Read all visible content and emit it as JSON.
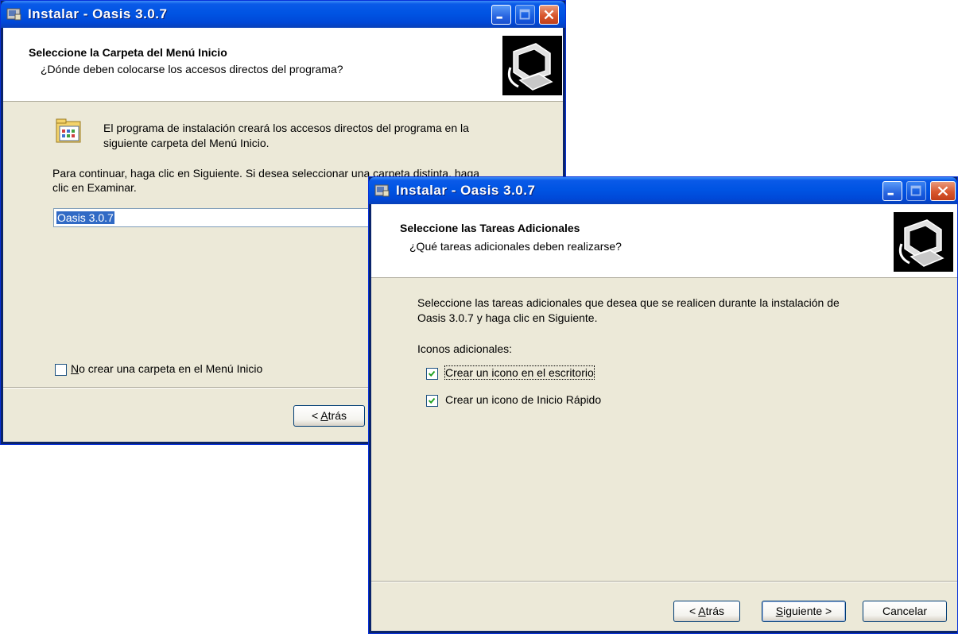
{
  "back_window": {
    "title": "Instalar - Oasis  3.0.7",
    "header_title": "Seleccione la Carpeta del Menú Inicio",
    "header_subtitle": "¿Dónde deben colocarse los accesos directos del programa?",
    "info_line1": "El programa de instalación creará los accesos directos del programa en la",
    "info_line2": "siguiente carpeta del Menú Inicio.",
    "continue_line1": "Para continuar, haga clic en Siguiente. Si desea seleccionar una carpeta distinta, haga",
    "continue_line2": "clic en Examinar.",
    "folder_value": "Oasis 3.0.7",
    "no_folder_check": {
      "label_rest": "o crear una carpeta en el Menú Inicio",
      "mnemonic": "N",
      "checked": false
    },
    "back_button": {
      "mnemonic": "A",
      "rest": "trás",
      "prefix": "< "
    }
  },
  "front_window": {
    "title": "Instalar - Oasis  3.0.7",
    "header_title": "Seleccione las Tareas Adicionales",
    "header_subtitle": "¿Qué tareas adicionales deben realizarse?",
    "desc_line1": "Seleccione las tareas adicionales que desea que se realicen durante la instalación de",
    "desc_line2": "Oasis  3.0.7 y haga clic en Siguiente.",
    "group_label": "Iconos adicionales:",
    "tasks": [
      {
        "label": "Crear un icono en el escritorio",
        "checked": true
      },
      {
        "label": "Crear un icono de Inicio Rápido",
        "checked": true
      }
    ],
    "buttons": {
      "back": {
        "prefix": "< ",
        "mnemonic": "A",
        "rest": "trás"
      },
      "next": {
        "mnemonic": "S",
        "rest": "iguiente >"
      },
      "cancel": "Cancelar"
    }
  },
  "colors": {
    "title_blue": "#0054e3",
    "face": "#ece9d8",
    "check_green": "#21a121"
  }
}
